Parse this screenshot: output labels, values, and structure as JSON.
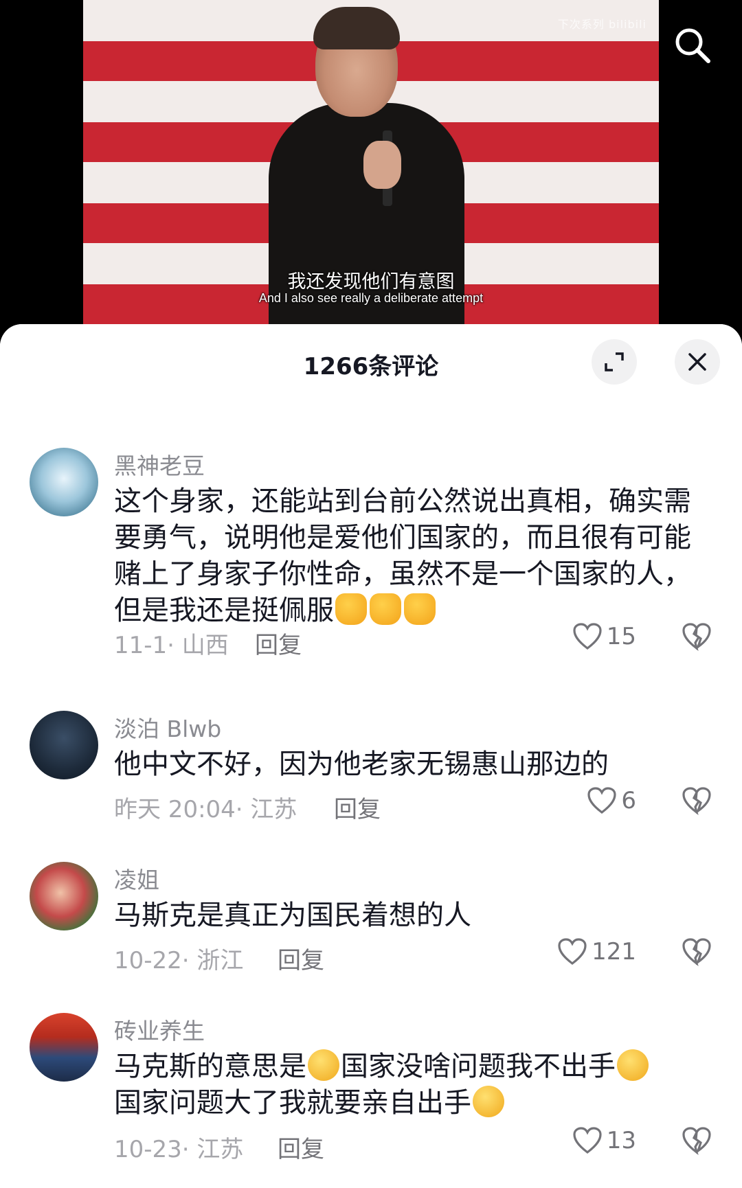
{
  "video": {
    "watermark": "下次系列 bilibili",
    "subtitle_cn": "我还发现他们有意图",
    "subtitle_en": "And I also see really a deliberate attempt",
    "search_icon": "search-icon"
  },
  "sheet": {
    "title": "1266条评论",
    "expand_icon": "expand-icon",
    "close_icon": "close-icon"
  },
  "comments": [
    {
      "username": "黑神老豆",
      "text": "这个身家，还能站到台前公然说出真相，确实需要勇气，说明他是爱他们国家的，而且很有可能赌上了身家子你性命，虽然不是一个国家的人，但是我还是挺佩服",
      "date": "11-1· 山西",
      "reply": "回复",
      "likes": "15"
    },
    {
      "username": "淡泊 Blwb",
      "text": "他中文不好，因为他老家无锡惠山那边的",
      "date": "昨天 20:04· 江苏",
      "reply": "回复",
      "likes": "6"
    },
    {
      "username": "凌姐",
      "text": "马斯克是真正为国民着想的人",
      "date": "10-22· 浙江",
      "reply": "回复",
      "likes": "121"
    },
    {
      "username": "砖业养生",
      "text_a": "马克斯的意思是",
      "text_b": "国家没啥问题我不出手",
      "text_c": "国家问题大了我就要亲自出手",
      "date": "10-23· 江苏",
      "reply": "回复",
      "likes": "13"
    }
  ],
  "colors": {
    "like_icon": "#737378",
    "text_primary": "#161823",
    "text_secondary": "#a6a6ab",
    "flag_red": "#c92632"
  }
}
